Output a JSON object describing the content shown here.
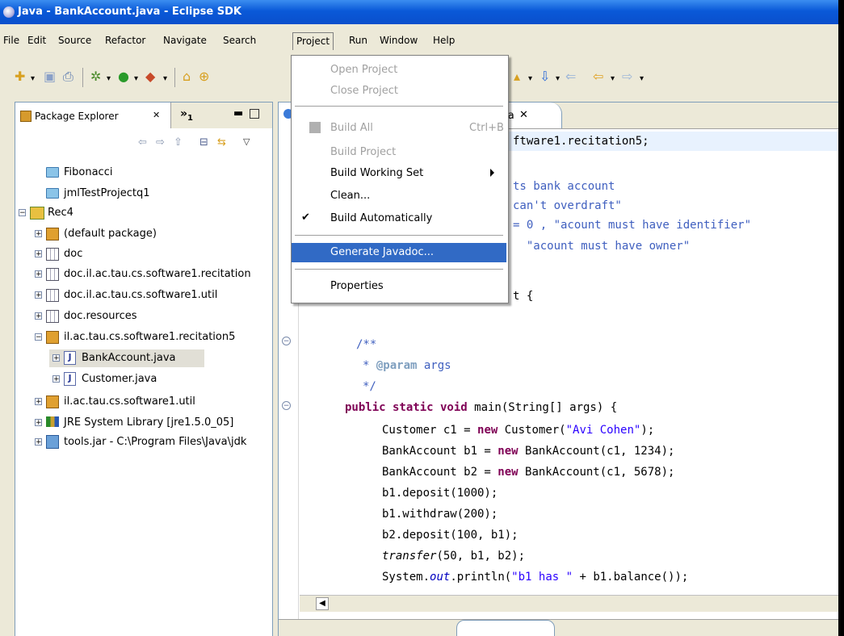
{
  "window": {
    "title": "Java - BankAccount.java - Eclipse SDK"
  },
  "menubar": [
    "File",
    "Edit",
    "Source",
    "Refactor",
    "Navigate",
    "Search",
    "Project",
    "Run",
    "Window",
    "Help"
  ],
  "active_menu": "Project",
  "project_menu": {
    "open_project": "Open Project",
    "close_project": "Close Project",
    "build_all": "Build All",
    "build_all_shortcut": "Ctrl+B",
    "build_project": "Build Project",
    "build_working_set": "Build Working Set",
    "clean": "Clean...",
    "build_automatically": "Build Automatically",
    "build_automatically_checked": true,
    "generate_javadoc": "Generate Javadoc...",
    "properties": "Properties"
  },
  "package_explorer": {
    "tab_label": "Package Explorer",
    "more_views": "»",
    "more_views_count": "1",
    "tree": [
      {
        "label": "Fibonacci",
        "icon": "folder-icon"
      },
      {
        "label": "jmlTestProjectq1",
        "icon": "folder-icon"
      },
      {
        "label": "Rec4",
        "icon": "project-icon"
      },
      {
        "label": "(default package)",
        "icon": "package-icon"
      },
      {
        "label": "doc",
        "icon": "source-folder-icon"
      },
      {
        "label": "doc.il.ac.tau.cs.software1.recitation",
        "icon": "source-folder-icon"
      },
      {
        "label": "doc.il.ac.tau.cs.software1.util",
        "icon": "source-folder-icon"
      },
      {
        "label": "doc.resources",
        "icon": "source-folder-icon"
      },
      {
        "label": "il.ac.tau.cs.software1.recitation5",
        "icon": "package-icon"
      },
      {
        "label": "BankAccount.java",
        "icon": "java-file-icon"
      },
      {
        "label": "Customer.java",
        "icon": "java-file-icon"
      },
      {
        "label": "il.ac.tau.cs.software1.util",
        "icon": "package-icon"
      },
      {
        "label": "JRE System Library [jre1.5.0_05]",
        "icon": "library-icon"
      },
      {
        "label": "tools.jar - C:\\Program Files\\Java\\jdk",
        "icon": "jar-icon"
      }
    ],
    "selected": "BankAccount.java"
  },
  "editor": {
    "tab_label": "va",
    "code_lines": [
      "ftware1.recitation5;",
      "",
      "ts bank account",
      "can't overdraft\"",
      "= 0 , \"acount must have identifier\"",
      "  \"acount must have owner\"",
      "",
      "t {",
      "",
      "/**",
      "* @param args",
      "*/",
      "public static void main(String[] args) {",
      "Customer c1 = new Customer(\"Avi Cohen\");",
      "BankAccount b1 = new BankAccount(c1, 1234);",
      "BankAccount b2 = new BankAccount(c1, 5678);",
      "b1.deposit(1000);",
      "b1.withdraw(200);",
      "b2.deposit(100, b1);",
      "transfer(50, b1, b2);",
      "System.out.println(\"b1 has \" + b1.balance());"
    ]
  },
  "colors": {
    "title_bar": "#0a59d8",
    "menu_highlight": "#316ac5",
    "keyword": "#7f0055",
    "string": "#2a00ff",
    "javadoc": "#3f5fbf"
  }
}
